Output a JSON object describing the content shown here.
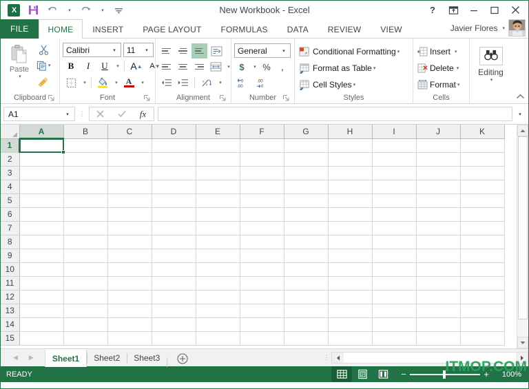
{
  "window": {
    "title": "New Workbook - Excel",
    "app_icon": "excel-logo-icon",
    "help_label": "?",
    "ribbon_display_label": "ribbon-display-options-icon",
    "minimize_label": "–",
    "maximize_label": "▢",
    "close_label": "✕"
  },
  "quick_access": [
    {
      "name": "save",
      "icon": "save-icon",
      "label": "Save"
    },
    {
      "name": "undo",
      "icon": "undo-icon",
      "label": "Undo"
    },
    {
      "name": "redo",
      "icon": "redo-icon",
      "label": "Redo"
    },
    {
      "name": "customize",
      "icon": "customize-quick-access-icon",
      "label": "Customize Quick Access Toolbar"
    }
  ],
  "ribbon_tabs": [
    {
      "label": "FILE",
      "active": false,
      "file": true
    },
    {
      "label": "HOME",
      "active": true
    },
    {
      "label": "INSERT",
      "active": false
    },
    {
      "label": "PAGE LAYOUT",
      "active": false
    },
    {
      "label": "FORMULAS",
      "active": false
    },
    {
      "label": "DATA",
      "active": false
    },
    {
      "label": "REVIEW",
      "active": false
    },
    {
      "label": "VIEW",
      "active": false
    }
  ],
  "account": {
    "name": "Javier Flores",
    "caret": "▾"
  },
  "ribbon": {
    "collapse_label": "^",
    "groups": {
      "clipboard": {
        "label": "Clipboard",
        "paste_label": "Paste",
        "paste_caret": "▾",
        "cut_label": "Cut",
        "copy_label": "Copy",
        "copy_caret": "▾",
        "format_painter_label": "Format Painter",
        "launcher": "⌐"
      },
      "font": {
        "label": "Font",
        "font_name": "Calibri",
        "font_size": "11",
        "bold_label": "B",
        "italic_label": "I",
        "underline_label": "U",
        "underline_caret": "▾",
        "grow_label": "A",
        "shrink_label": "A",
        "borders_label": "Borders",
        "borders_caret": "▾",
        "fill_label": "Fill Color",
        "fill_caret": "▾",
        "fontcolor_label": "A",
        "fontcolor_caret": "▾",
        "launcher": "⌐"
      },
      "alignment": {
        "label": "Alignment",
        "align_top": "Top Align",
        "align_middle": "Middle Align",
        "align_bottom": "Bottom Align",
        "wrap_text": "Wrap Text",
        "align_left": "Align Left",
        "align_center": "Center",
        "align_right": "Align Right",
        "merge_label": "Merge & Center",
        "merge_caret": "▾",
        "decrease_indent": "Decrease Indent",
        "increase_indent": "Increase Indent",
        "orientation": "Orientation",
        "orientation_caret": "▾",
        "launcher": "⌐"
      },
      "number": {
        "label": "Number",
        "format": "General",
        "format_caret": "▾",
        "currency_label": "$",
        "currency_caret": "▾",
        "percent_label": "%",
        "comma_label": ",",
        "increase_decimal": ".00",
        "decrease_decimal": ".00",
        "launcher": "⌐"
      },
      "styles": {
        "label": "Styles",
        "items": [
          {
            "label": "Conditional Formatting",
            "caret": "▾",
            "icon": "conditional-formatting-icon"
          },
          {
            "label": "Format as Table",
            "caret": "▾",
            "icon": "format-as-table-icon"
          },
          {
            "label": "Cell Styles",
            "caret": "▾",
            "icon": "cell-styles-icon"
          }
        ]
      },
      "cells": {
        "label": "Cells",
        "items": [
          {
            "label": "Insert",
            "caret": "▾",
            "icon": "insert-cells-icon"
          },
          {
            "label": "Delete",
            "caret": "▾",
            "icon": "delete-cells-icon"
          },
          {
            "label": "Format",
            "caret": "▾",
            "icon": "format-cells-icon"
          }
        ]
      },
      "editing": {
        "label": "Editing",
        "button_label": "Editing",
        "caret": "▾",
        "icon": "find-select-icon"
      }
    }
  },
  "formula_bar": {
    "name_box_value": "A1",
    "name_box_caret": "▾",
    "cancel_label": "✕",
    "enter_label": "✓",
    "function_label": "fx",
    "formula_value": "",
    "expand_caret": "▾"
  },
  "grid": {
    "columns": [
      "A",
      "B",
      "C",
      "D",
      "E",
      "F",
      "G",
      "H",
      "I",
      "J",
      "K"
    ],
    "rows": [
      "1",
      "2",
      "3",
      "4",
      "5",
      "6",
      "7",
      "8",
      "9",
      "10",
      "11",
      "12",
      "13",
      "14",
      "15"
    ],
    "selected_cell": "A1",
    "selected_column": "A",
    "selected_row": "1",
    "scroll_up_label": "▲",
    "scroll_down_label": "▼",
    "scroll_left_label": "◀",
    "scroll_right_label": "▶"
  },
  "sheet_tabs": {
    "first_label": "◀",
    "prev_label": "◀",
    "next_label": "▶",
    "last_label": "▶",
    "tabs": [
      {
        "label": "Sheet1",
        "active": true
      },
      {
        "label": "Sheet2",
        "active": false
      },
      {
        "label": "Sheet3",
        "active": false
      }
    ],
    "add_label": "+"
  },
  "status_bar": {
    "state": "READY",
    "views": [
      {
        "name": "normal-view",
        "icon": "normal-view-icon",
        "active": true
      },
      {
        "name": "page-layout-view",
        "icon": "page-layout-view-icon",
        "active": false
      },
      {
        "name": "page-break-preview",
        "icon": "page-break-preview-icon",
        "active": false
      }
    ],
    "zoom_out_label": "−",
    "zoom_in_label": "+",
    "zoom_level": "100%"
  },
  "watermark": {
    "text": "ITMOP.COM"
  },
  "colors": {
    "excel_green": "#217346",
    "status_bar": "#217346",
    "selection": "#217346",
    "header_bg": "#f0f0f0",
    "gridline": "#d7d7d7"
  }
}
